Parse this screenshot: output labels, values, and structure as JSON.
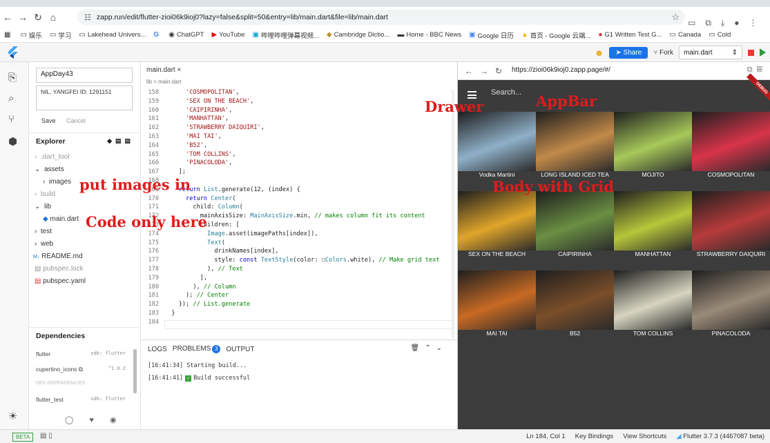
{
  "browser": {
    "url": "zapp.run/edit/flutter-zioi06k9ioj0?lazy=false&split=50&entry=lib/main.dart&file=lib/main.dart",
    "bookmarks": [
      "娱乐",
      "学习",
      "Lakehead Univers...",
      "ChatGPT",
      "YouTube",
      "哔哩哔哩弹幕视频...",
      "Cambridge Dictio...",
      "Home - BBC News",
      "Google 日历",
      "首页 - Google 云端...",
      "G1 Written Test G...",
      "Canada",
      "Cold"
    ]
  },
  "toolbar": {
    "share": "Share",
    "fork": "Fork",
    "file": "main.dart"
  },
  "sidebar": {
    "project_name": "AppDay43",
    "project_desc": "NIL, YANGFEI ID: 1291151",
    "save": "Save",
    "cancel": "Cancel",
    "explorer_title": "Explorer",
    "tree": [
      ".dart_tool",
      "assets",
      "images",
      "build",
      "lib",
      "main.dart",
      "test",
      "web",
      "README.md",
      "pubspec.lock",
      "pubspec.yaml"
    ],
    "deps_title": "Dependencies",
    "deps": [
      {
        "name": "flutter",
        "ver": "sdk: flutter"
      },
      {
        "name": "cupertino_icons ⧉",
        "ver": "^1.0.2"
      },
      {
        "name": "DEV DEPENDENCIES",
        "ver": ""
      },
      {
        "name": "flutter_test",
        "ver": "sdk: flutter"
      }
    ]
  },
  "editor": {
    "tab": "main.dart ×",
    "breadcrumb": "lib > main.dart",
    "lines": [
      "158",
      "159",
      "160",
      "161",
      "162",
      "163",
      "164",
      "165",
      "166",
      "167",
      "168",
      "169",
      "170",
      "171",
      "172",
      "173",
      "174",
      "175",
      "176",
      "177",
      "178",
      "179",
      "180",
      "181",
      "182",
      "183",
      "184"
    ]
  },
  "console": {
    "tabs": [
      "LOGS",
      "PROBLEMS",
      "OUTPUT"
    ],
    "problems": "3",
    "logs": [
      "[16:41:34] Starting build...",
      "[16:41:41]",
      "Build successful"
    ]
  },
  "preview": {
    "url": "https://zioi06k9ioj0.zapp.page/#/",
    "search": "Search...",
    "debug": "DEBUG",
    "drinks": [
      "Vodka Martini",
      "LONG ISLAND ICED TEA",
      "MOJITO",
      "COSMOPOLITAN",
      "SEX ON THE BEACH",
      "CAIPIRINHA",
      "MANHATTAN",
      "STRAWBERRY DAIQUIRI",
      "MAI TAI",
      "B52",
      "TOM COLLINS",
      "PINACOLODA"
    ],
    "colors": [
      "#8fb0c8",
      "#c28a4a",
      "#a7c95a",
      "#d8344a",
      "#e0a52a",
      "#6a8f43",
      "#b7c63a",
      "#b73b3b",
      "#c86a24",
      "#7a4e2a",
      "#d7d5c0",
      "#9a8a78"
    ]
  },
  "annotations": {
    "drawer": "Drawer",
    "appbar": "AppBar",
    "images": "put images in",
    "grid": "Body with Grid",
    "code": "Code only here"
  },
  "status": {
    "beta": "BETA",
    "position": "Ln 184, Col 1",
    "keybind": "Key Bindings",
    "shortcuts": "View Shortcuts",
    "version": "Flutter 3.7.3  (4467087 beta)"
  }
}
